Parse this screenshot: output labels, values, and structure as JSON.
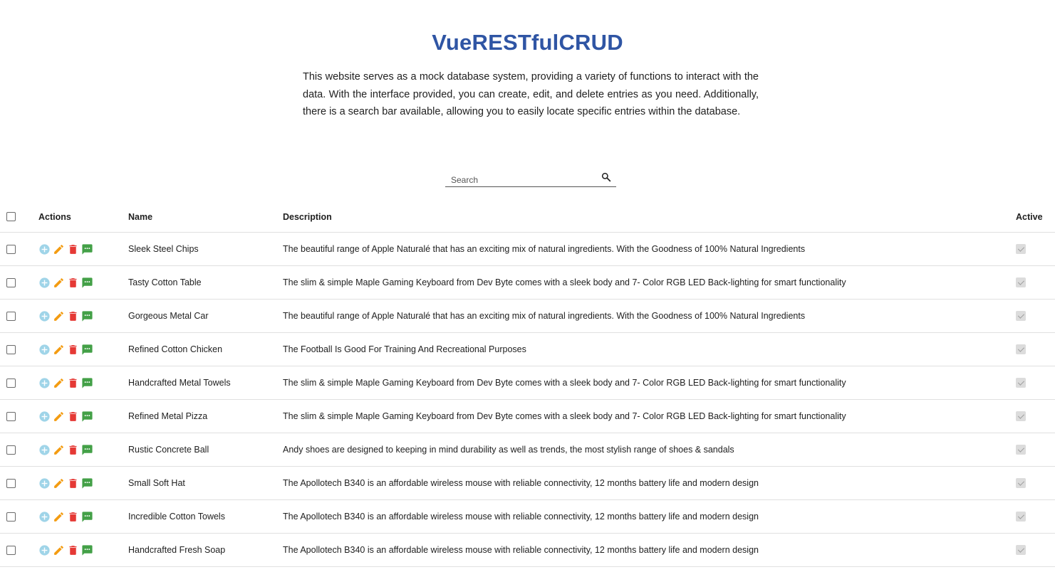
{
  "header": {
    "title": "VueRESTfulCRUD",
    "intro": "This website serves as a mock database system, providing a variety of functions to interact with the data. With the interface provided, you can create, edit, and delete entries as you need. Additionally, there is a search bar available, allowing you to easily locate specific entries within the database."
  },
  "search": {
    "placeholder": "Search",
    "value": "",
    "icon": "search-icon"
  },
  "table": {
    "columns": {
      "actions": "Actions",
      "name": "Name",
      "description": "Description",
      "active": "Active"
    },
    "action_icons": [
      "add-circle-icon",
      "pencil-icon",
      "trash-icon",
      "comment-icon"
    ],
    "colors": {
      "add": "#9fd4e8",
      "edit": "#f39c12",
      "delete": "#e53935",
      "comment": "#43a047"
    },
    "rows": [
      {
        "name": "Sleek Steel Chips",
        "description": "The beautiful range of Apple Naturalé that has an exciting mix of natural ingredients. With the Goodness of 100% Natural Ingredients",
        "active": true
      },
      {
        "name": "Tasty Cotton Table",
        "description": "The slim & simple Maple Gaming Keyboard from Dev Byte comes with a sleek body and 7- Color RGB LED Back-lighting for smart functionality",
        "active": true
      },
      {
        "name": "Gorgeous Metal Car",
        "description": "The beautiful range of Apple Naturalé that has an exciting mix of natural ingredients. With the Goodness of 100% Natural Ingredients",
        "active": true
      },
      {
        "name": "Refined Cotton Chicken",
        "description": "The Football Is Good For Training And Recreational Purposes",
        "active": true
      },
      {
        "name": "Handcrafted Metal Towels",
        "description": "The slim & simple Maple Gaming Keyboard from Dev Byte comes with a sleek body and 7- Color RGB LED Back-lighting for smart functionality",
        "active": true
      },
      {
        "name": "Refined Metal Pizza",
        "description": "The slim & simple Maple Gaming Keyboard from Dev Byte comes with a sleek body and 7- Color RGB LED Back-lighting for smart functionality",
        "active": true
      },
      {
        "name": "Rustic Concrete Ball",
        "description": "Andy shoes are designed to keeping in mind durability as well as trends, the most stylish range of shoes & sandals",
        "active": true
      },
      {
        "name": "Small Soft Hat",
        "description": "The Apollotech B340 is an affordable wireless mouse with reliable connectivity, 12 months battery life and modern design",
        "active": true
      },
      {
        "name": "Incredible Cotton Towels",
        "description": "The Apollotech B340 is an affordable wireless mouse with reliable connectivity, 12 months battery life and modern design",
        "active": true
      },
      {
        "name": "Handcrafted Fresh Soap",
        "description": "The Apollotech B340 is an affordable wireless mouse with reliable connectivity, 12 months battery life and modern design",
        "active": true
      },
      {
        "name": "",
        "description": "",
        "active": true
      }
    ]
  }
}
